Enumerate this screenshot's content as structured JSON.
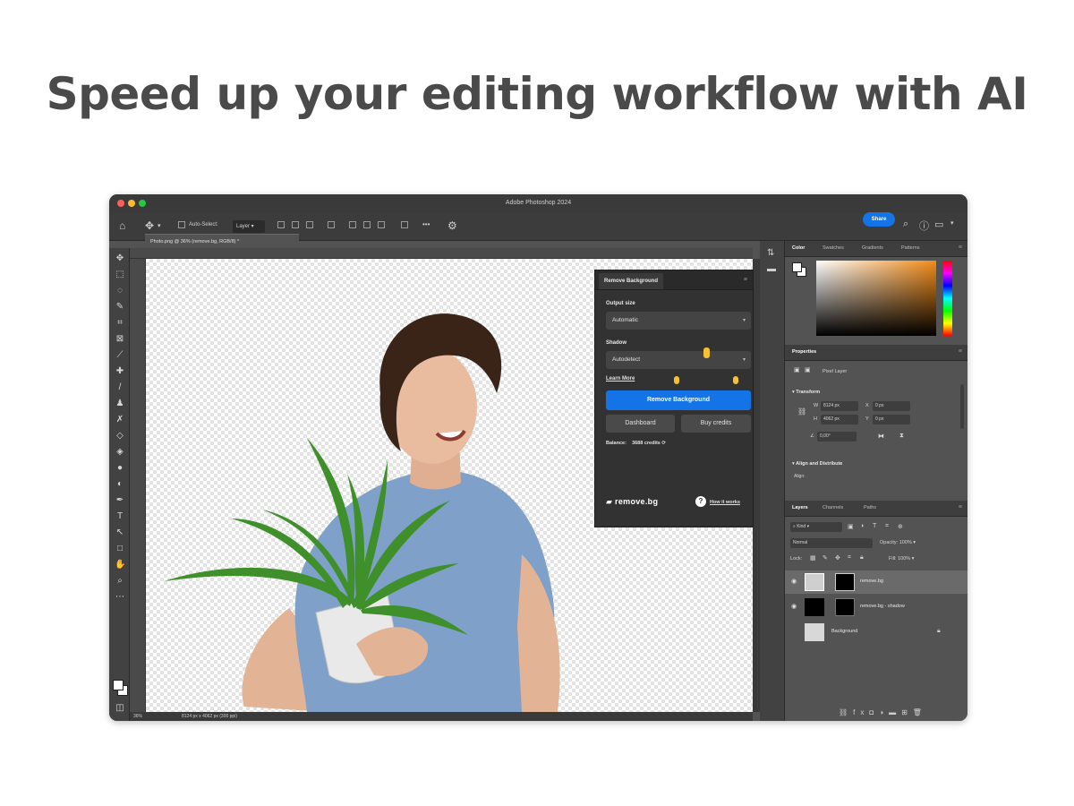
{
  "headline": "Speed up your editing workflow with AI",
  "window": {
    "title": "Adobe Photoshop 2024"
  },
  "options_bar": {
    "auto_select": "Auto-Select:",
    "layer_select": "Layer",
    "more": "•••",
    "share": "Share"
  },
  "document": {
    "tab": "Photo.png @ 36% (remove.bg, RGB/8) *",
    "zoom": "36%",
    "info": "8124 px x 4062 px (300 ppi)"
  },
  "remove_bg_panel": {
    "tab": "Remove Background",
    "output_label": "Output size",
    "output_value": "Automatic",
    "shadow_label": "Shadow",
    "shadow_value": "Autodetect",
    "learn_more": "Learn More",
    "primary_button": "Remove Background",
    "dashboard": "Dashboard",
    "buy_credits": "Buy credits",
    "balance_label": "Balance:",
    "balance_value": "3688 credits",
    "logo": "remove.bg",
    "how_it_works": "How it works"
  },
  "color_panel": {
    "tabs": [
      "Color",
      "Swatches",
      "Gradients",
      "Patterns"
    ]
  },
  "properties": {
    "tab": "Properties",
    "layer_type": "Pixel Layer",
    "transform": "Transform",
    "w_label": "W",
    "w_value": "8124 px",
    "h_label": "H",
    "h_value": "4062 px",
    "x_label": "X",
    "x_value": "0 px",
    "y_label": "Y",
    "y_value": "0 px",
    "angle": "0,00°",
    "align": "Align and Distribute",
    "align_sub": "Align:"
  },
  "layers": {
    "tabs": [
      "Layers",
      "Channels",
      "Paths"
    ],
    "kind": "Kind",
    "blend": "Normal",
    "opacity": "Opacity: 100%",
    "lock": "Lock:",
    "fill": "Fill: 100%",
    "items": [
      "remove.bg",
      "remove.bg - shadow",
      "Background"
    ]
  },
  "colors": {
    "accent": "#1473e6",
    "panel": "#535353",
    "headline": "#4a4a4a",
    "orange": "#f28c18",
    "cursor": "#f2c230"
  },
  "icons": [
    "home-icon",
    "move-icon",
    "search-icon",
    "help-icon",
    "window-icon",
    "gear-icon",
    "eye-icon",
    "lock-icon",
    "trash-icon"
  ]
}
